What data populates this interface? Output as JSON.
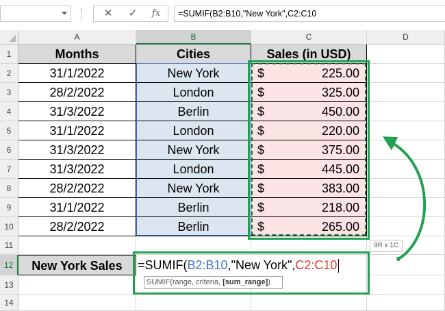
{
  "formula_bar": {
    "name_box": "",
    "cancel_icon": "✕",
    "enter_icon": "✓",
    "fx_label": "fx",
    "formula": "=SUMIF(B2:B10,\"New York\",C2:C10"
  },
  "columns": [
    "A",
    "B",
    "C",
    "D"
  ],
  "rows": [
    "1",
    "2",
    "3",
    "4",
    "5",
    "6",
    "7",
    "8",
    "9",
    "10",
    "11",
    "12",
    "13",
    "14"
  ],
  "headers": {
    "months": "Months",
    "cities": "Cities",
    "sales": "Sales (in USD)"
  },
  "table": [
    {
      "month": "31/1/2022",
      "city": "New York",
      "currency": "$",
      "sales": "225.00"
    },
    {
      "month": "28/2/2022",
      "city": "London",
      "currency": "$",
      "sales": "325.00"
    },
    {
      "month": "31/3/2022",
      "city": "Berlin",
      "currency": "$",
      "sales": "450.00"
    },
    {
      "month": "31/1/2022",
      "city": "London",
      "currency": "$",
      "sales": "220.00"
    },
    {
      "month": "31/3/2022",
      "city": "New York",
      "currency": "$",
      "sales": "375.00"
    },
    {
      "month": "31/3/2022",
      "city": "London",
      "currency": "$",
      "sales": "445.00"
    },
    {
      "month": "28/2/2022",
      "city": "New York",
      "currency": "$",
      "sales": "383.00"
    },
    {
      "month": "31/1/2022",
      "city": "Berlin",
      "currency": "$",
      "sales": "218.00"
    },
    {
      "month": "28/2/2022",
      "city": "Berlin",
      "currency": "$",
      "sales": "265.00"
    }
  ],
  "summary_label": "New York Sales",
  "edit_formula": {
    "prefix": "=SUMIF(",
    "range1": "B2:B10",
    "criteria": ",\"New York\",",
    "range2": "C2:C10"
  },
  "tooltip": {
    "func": "SUMIF(range, criteria, ",
    "bold_arg": "[sum_range]",
    "suffix": ")"
  },
  "size_tip": "9R x 1C",
  "colors": {
    "accent_green": "#21a150",
    "blue_ref": "#4472c4",
    "red_ref": "#e03c31",
    "header_fill": "#d9d9d9",
    "cities_fill": "#dce6f1",
    "sales_fill": "#fce4e4"
  }
}
